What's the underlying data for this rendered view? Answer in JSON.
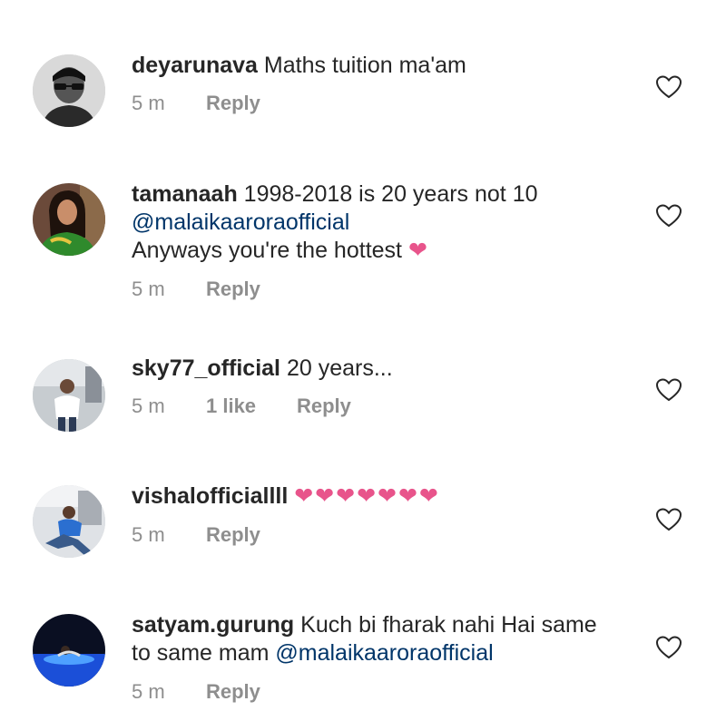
{
  "comments": [
    {
      "username": "deyarunava",
      "text": " Maths tuition ma'am",
      "time": "5 m",
      "reply": "Reply",
      "avatar_icon": "man-sunglasses-avatar"
    },
    {
      "username": "tamanaah",
      "text": " 1998-2018 is 20 years not 10",
      "mention": "@malaikaaroraofficial",
      "text2": "Anyways you're the hottest",
      "emoji": "❤",
      "time": "5 m",
      "reply": "Reply",
      "avatar_icon": "woman-selfie-avatar"
    },
    {
      "username": "sky77_official",
      "text": " 20 years...",
      "time": "5 m",
      "likes": "1 like",
      "reply": "Reply",
      "avatar_icon": "man-standing-avatar"
    },
    {
      "username": "vishalofficiallll",
      "emojis": "❤❤❤❤❤❤❤",
      "time": "5 m",
      "reply": "Reply",
      "avatar_icon": "man-sitting-avatar"
    },
    {
      "username": "satyam.gurung",
      "text": " Kuch bi fharak nahi Hai same",
      "text2": "to same mam ",
      "mention": "@malaikaaroraofficial",
      "time": "5 m",
      "reply": "Reply",
      "avatar_icon": "pool-night-avatar"
    }
  ],
  "colors": {
    "text": "#262626",
    "meta": "#8e8e8e",
    "mention": "#003569",
    "heart": "#e8548b"
  }
}
